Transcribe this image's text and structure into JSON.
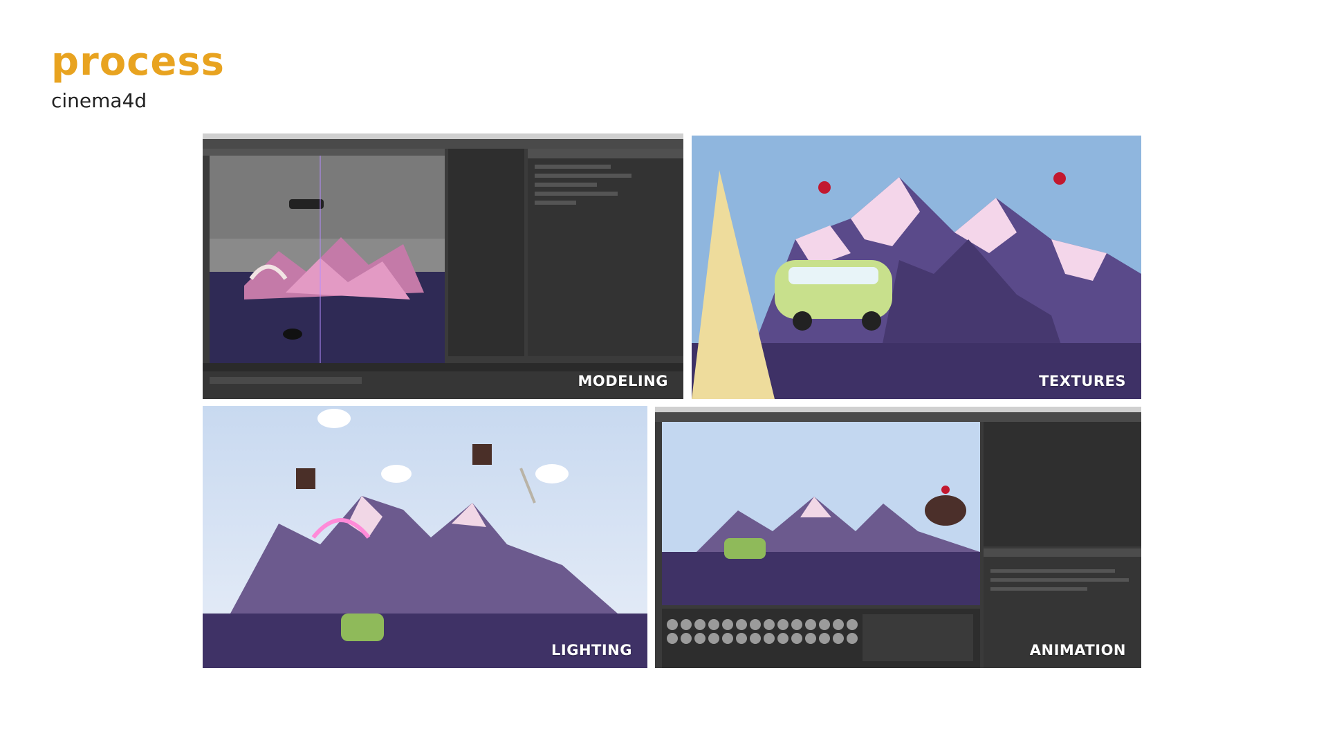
{
  "header": {
    "title": "process",
    "subtitle": "cinema4d"
  },
  "panels": [
    {
      "label": "MODELING"
    },
    {
      "label": "TEXTURES"
    },
    {
      "label": "LIGHTING"
    },
    {
      "label": "ANIMATION"
    }
  ],
  "colors": {
    "accent": "#e8a320",
    "mountain": "#5a4a8a",
    "ground": "#45366e",
    "sky": "#8fb6de",
    "snow": "#f4d6ea",
    "ui_dark": "#3a3a3a"
  },
  "icons": [
    "scene-viewport-icon",
    "van-icon",
    "cone-icon",
    "cherry-icon",
    "rainbow-icon",
    "cloud-icon",
    "cup-icon",
    "spoon-icon"
  ]
}
